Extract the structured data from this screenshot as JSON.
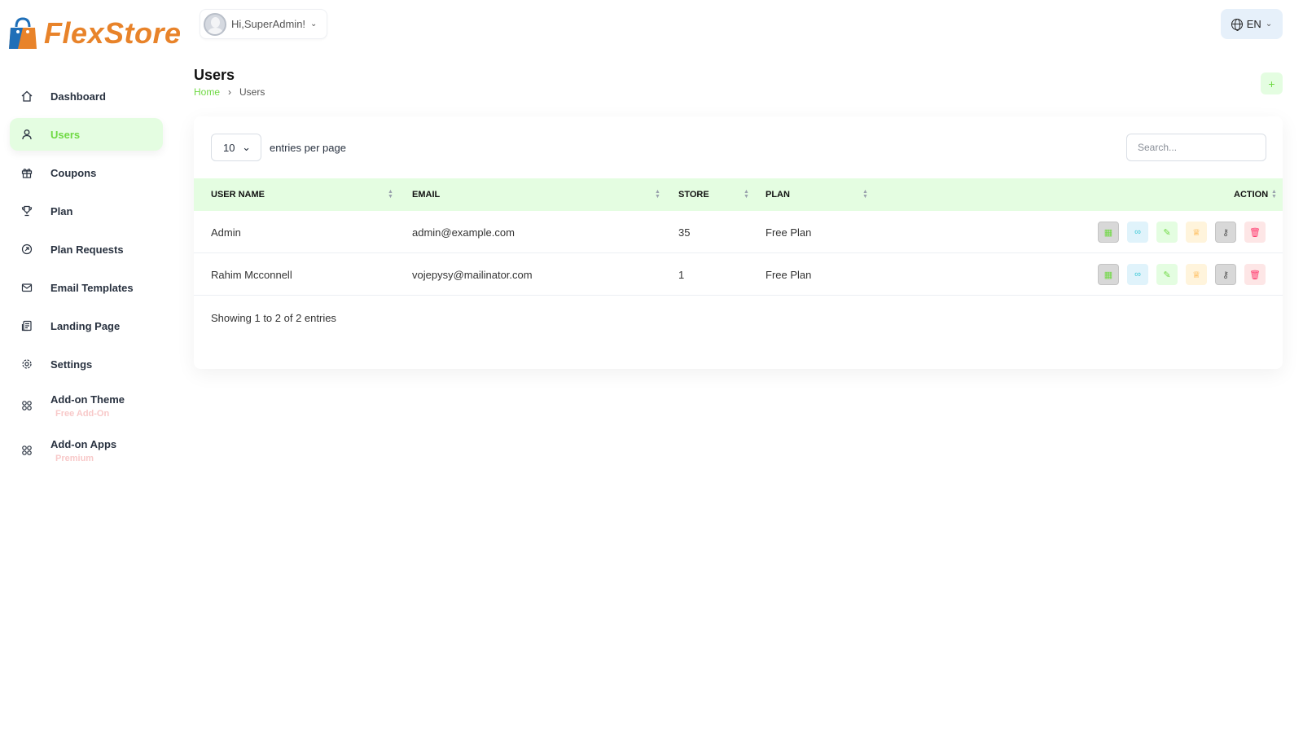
{
  "brand": {
    "name": "FlexStore",
    "color": "#e8832a"
  },
  "header": {
    "greeting": "Hi,SuperAdmin!",
    "language": "EN"
  },
  "sidebar": {
    "items": [
      {
        "label": "Dashboard",
        "icon": "home-icon"
      },
      {
        "label": "Users",
        "icon": "user-icon",
        "active": true
      },
      {
        "label": "Coupons",
        "icon": "gift-icon"
      },
      {
        "label": "Plan",
        "icon": "trophy-icon"
      },
      {
        "label": "Plan Requests",
        "icon": "request-icon"
      },
      {
        "label": "Email Templates",
        "icon": "mail-icon"
      },
      {
        "label": "Landing Page",
        "icon": "page-icon"
      },
      {
        "label": "Settings",
        "icon": "gear-icon"
      },
      {
        "label": "Add-on Theme",
        "sub": "Free Add-On",
        "icon": "apps-icon"
      },
      {
        "label": "Add-on Apps",
        "sub": "Premium",
        "icon": "apps-icon"
      }
    ]
  },
  "page": {
    "title": "Users",
    "breadcrumb": [
      "Home",
      "Users"
    ]
  },
  "table": {
    "entries_value": "10",
    "entries_label": "entries per page",
    "search_placeholder": "Search...",
    "columns": [
      "USER NAME",
      "EMAIL",
      "STORE",
      "PLAN",
      "ACTION"
    ],
    "rows": [
      {
        "name": "Admin",
        "email": "admin@example.com",
        "store": "35",
        "plan": "Free Plan"
      },
      {
        "name": "Rahim Mcconnell",
        "email": "vojepysy@mailinator.com",
        "store": "1",
        "plan": "Free Plan"
      }
    ],
    "info": "Showing 1 to 2 of 2 entries"
  },
  "colors": {
    "accent": "#6fd943",
    "accent_bg": "#e4fde1",
    "danger": "#ff3a6e",
    "warning": "#ffa21d",
    "info": "#3ec9d6"
  }
}
